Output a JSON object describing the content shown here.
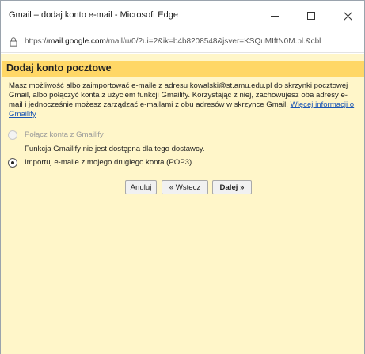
{
  "window": {
    "title": "Gmail – dodaj konto e-mail - Microsoft Edge"
  },
  "address_bar": {
    "url_prefix": "https://",
    "url_host": "mail.google.com",
    "url_rest": "/mail/u/0/?ui=2&ik=b4b8208548&jsver=KSQuMIftN0M.pl.&cbl"
  },
  "page": {
    "title": "Dodaj konto pocztowe",
    "description": "Masz możliwość albo zaimportować e-maile z adresu kowalski@st.amu.edu.pl do skrzynki pocztowej Gmail, albo połączyć konta z użyciem funkcji Gmailify. Korzystając z niej, zachowujesz oba adresy e-mail i jednocześnie możesz zarządzać e-mailami z obu adresów w skrzynce Gmail.",
    "learn_more_link": "Więcej informacji o Gmailify",
    "options": {
      "gmailify_label": "Połącz konta z Gmailify",
      "gmailify_note": "Funkcja Gmailify nie jest dostępna dla tego dostawcy.",
      "pop3_label": "Importuj e-maile z mojego drugiego konta (POP3)"
    },
    "buttons": {
      "cancel": "Anuluj",
      "back": "« Wstecz",
      "next": "Dalej »"
    }
  },
  "colors": {
    "header_bg": "#ffd766",
    "content_bg": "#fff6c9",
    "link": "#1a55b5"
  }
}
